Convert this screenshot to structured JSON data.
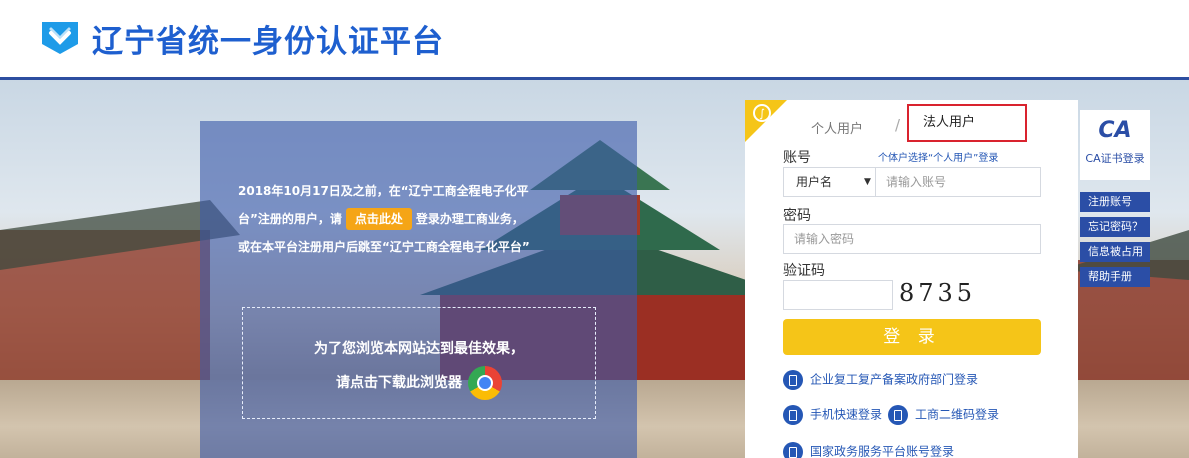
{
  "header": {
    "title": "辽宁省统一身份认证平台"
  },
  "notice": {
    "line1": "2018年10月17日及之前，在“辽宁工商全程电子化平",
    "line2_pre": "台”注册的用户，请",
    "button": "点击此处",
    "line2_post": "登录办理工商业务，",
    "line3": "或在本平台注册用户后跳至“辽宁工商全程电子化平台”",
    "browser_line1": "为了您浏览本网站达到最佳效果，",
    "browser_line2": "请点击下载此浏览器"
  },
  "login": {
    "tab_personal": "个人用户",
    "tab_separator": "/",
    "tab_legal": "法人用户",
    "account_label": "账号",
    "account_hint": "个体户选择“个人用户”登录",
    "account_type": "用户名",
    "account_placeholder": "请输入账号",
    "password_label": "密码",
    "password_placeholder": "请输入密码",
    "captcha_label": "验证码",
    "captcha_code": "8735",
    "submit": "登 录",
    "link_enterprise": "企业复工复产备案政府部门登录",
    "link_mobile": "手机快速登录",
    "link_qr": "工商二维码登录",
    "link_national": "国家政务服务平台账号登录"
  },
  "ca": {
    "logo": "CA",
    "label": "CA证书登录",
    "links": [
      "注册账号",
      "忘记密码？",
      "信息被占用",
      "帮助手册"
    ]
  },
  "colors": {
    "brand": "#1e5fcf",
    "accent": "#f5c518",
    "panel": "#2b4ea6"
  }
}
